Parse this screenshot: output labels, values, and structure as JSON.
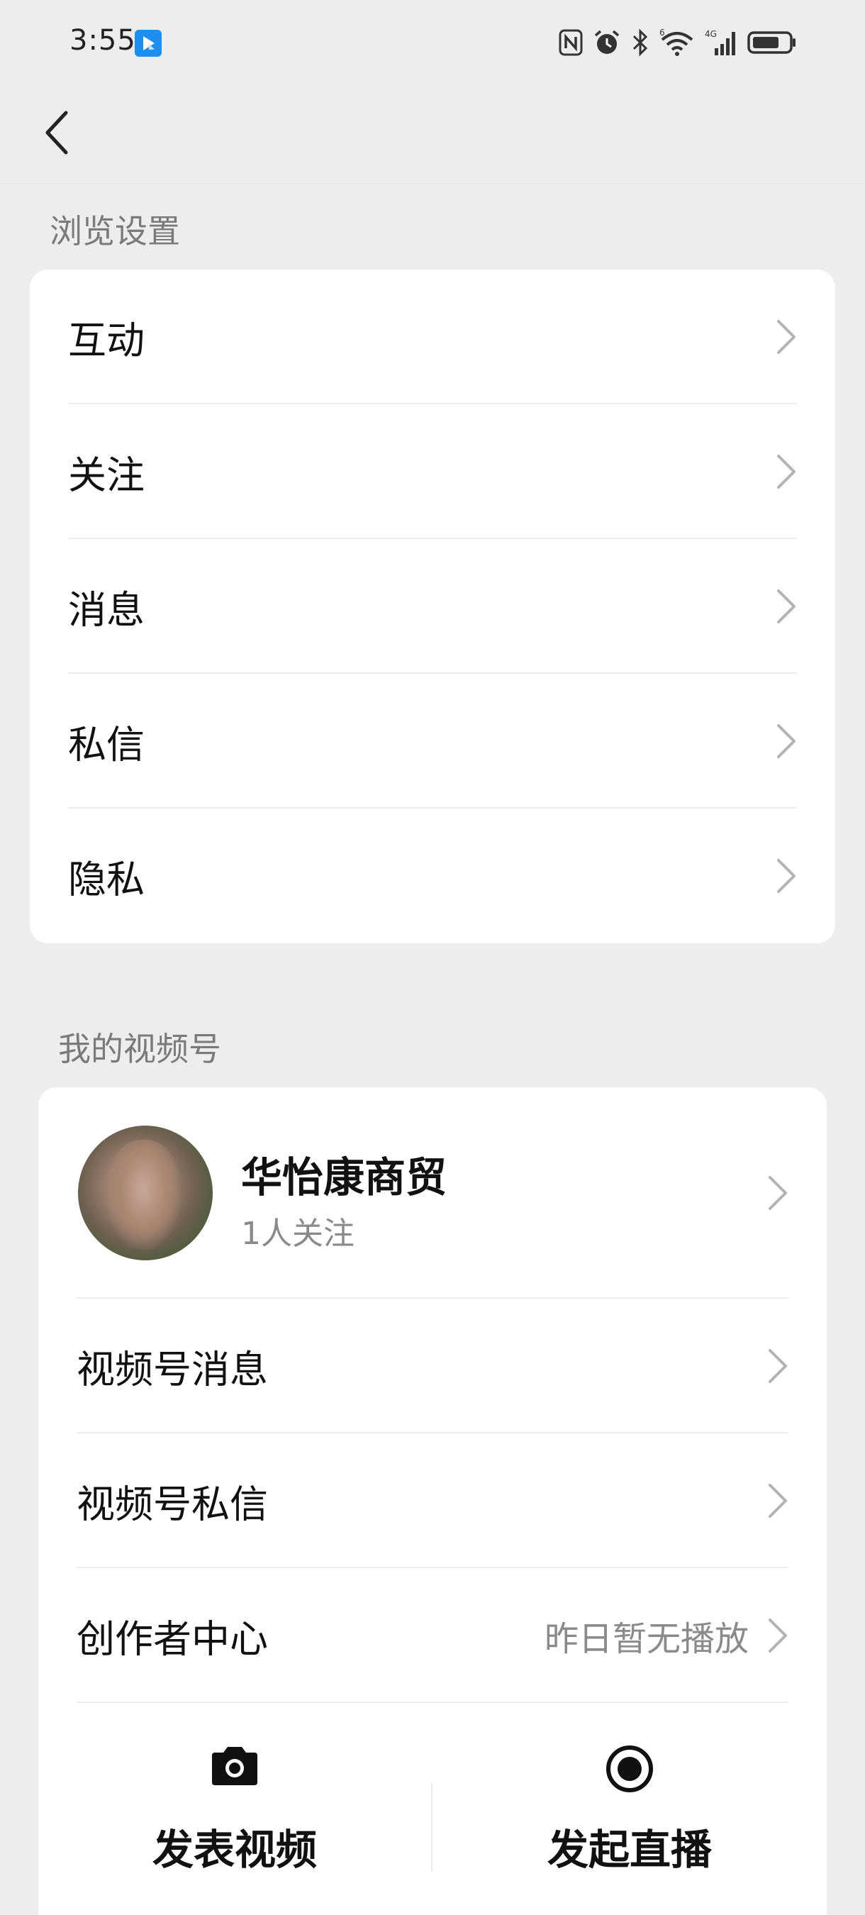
{
  "status_bar": {
    "time": "3:55",
    "icons": [
      "app-notification-icon",
      "nfc-icon",
      "alarm-icon",
      "bluetooth-icon",
      "wifi-icon",
      "signal-icon",
      "battery-icon"
    ],
    "network_labels": {
      "wifi": "6",
      "cellular": "4G"
    }
  },
  "nav": {
    "back_icon": "chevron-left-icon"
  },
  "browse_section": {
    "title": "浏览设置",
    "items": [
      {
        "label": "互动"
      },
      {
        "label": "关注"
      },
      {
        "label": "消息"
      },
      {
        "label": "私信"
      },
      {
        "label": "隐私"
      }
    ]
  },
  "channel_section": {
    "title": "我的视频号",
    "profile": {
      "name": "华怡康商贸",
      "followers": "1人关注"
    },
    "items": [
      {
        "label": "视频号消息",
        "value": ""
      },
      {
        "label": "视频号私信",
        "value": ""
      },
      {
        "label": "创作者中心",
        "value": "昨日暂无播放"
      }
    ],
    "actions": [
      {
        "label": "发表视频",
        "icon": "camera-icon"
      },
      {
        "label": "发起直播",
        "icon": "live-record-icon"
      }
    ]
  },
  "colors": {
    "background": "#ededed",
    "card": "#ffffff",
    "text_primary": "#111111",
    "text_secondary": "#8a8a8a",
    "chevron": "#b3b3b3"
  }
}
